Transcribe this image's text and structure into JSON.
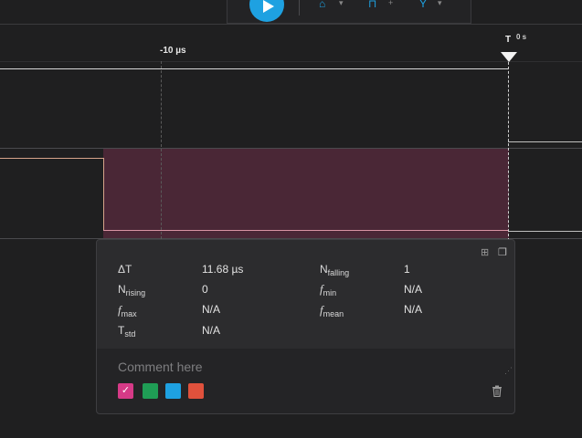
{
  "toolbar": {
    "play_icon": "play-icon",
    "tools": [
      "trigger-icon",
      "measure-icon",
      "marker-icon"
    ]
  },
  "timeline": {
    "cursor_label": "-10 µs",
    "trigger_marker": "T",
    "trigger_suffix": "0 s"
  },
  "colors": {
    "accent": "#1ea1e1",
    "measure_region": "#4a2736",
    "channel_orange": "#d6a38a",
    "channel_pink": "#d994a4"
  },
  "measurements": {
    "delta_t": {
      "label": "ΔT",
      "value": "11.68 µs"
    },
    "n_falling": {
      "label": "N",
      "sub": "falling",
      "value": "1"
    },
    "n_rising": {
      "label": "N",
      "sub": "rising",
      "value": "0"
    },
    "f_min": {
      "label": "f",
      "sub": "min",
      "value": "N/A"
    },
    "f_max": {
      "label": "f",
      "sub": "max",
      "value": "N/A"
    },
    "f_mean": {
      "label": "f",
      "sub": "mean",
      "value": "N/A"
    },
    "t_std": {
      "label": "T",
      "sub": "std",
      "value": "N/A"
    }
  },
  "comment": {
    "placeholder": "Comment here",
    "value": ""
  },
  "swatches": [
    {
      "color": "#d63a87",
      "selected": true
    },
    {
      "color": "#1f9d55",
      "selected": false
    },
    {
      "color": "#1ea1e1",
      "selected": false
    },
    {
      "color": "#e0513c",
      "selected": false
    }
  ],
  "panel_icons": [
    "expand-icon",
    "copy-icon",
    "trash-icon"
  ]
}
